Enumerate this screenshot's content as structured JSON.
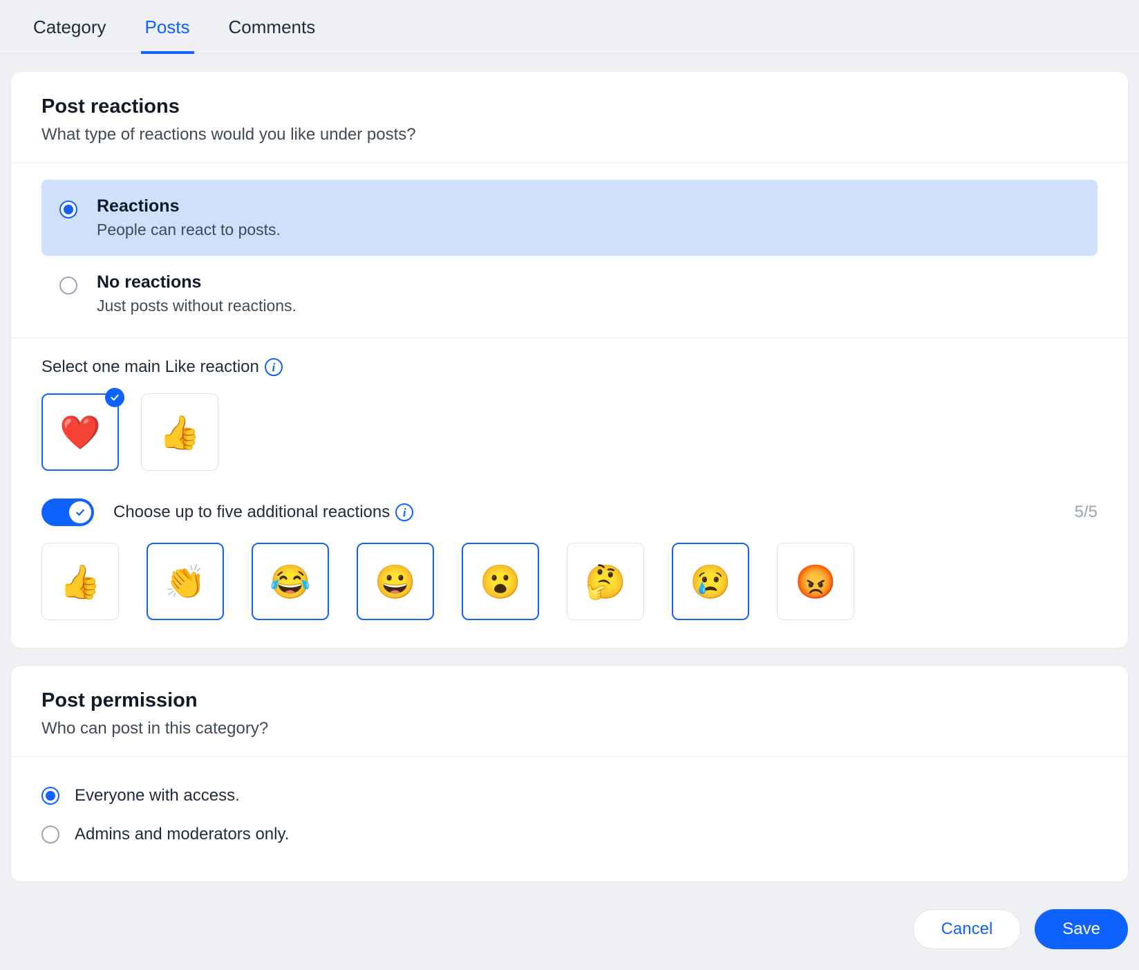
{
  "tabs": [
    {
      "id": "category",
      "label": "Category",
      "active": false
    },
    {
      "id": "posts",
      "label": "Posts",
      "active": true
    },
    {
      "id": "comments",
      "label": "Comments",
      "active": false
    }
  ],
  "reactions_section": {
    "title": "Post reactions",
    "subtitle": "What type of reactions would you like under posts?",
    "options": [
      {
        "id": "reactions-on",
        "title": "Reactions",
        "desc": "People can react to posts.",
        "selected": true
      },
      {
        "id": "reactions-off",
        "title": "No reactions",
        "desc": "Just posts without reactions.",
        "selected": false
      }
    ],
    "main_like_label": "Select one main Like reaction",
    "main_like_choices": [
      {
        "id": "heart",
        "emoji": "❤️",
        "selected": true
      },
      {
        "id": "thumbs-up",
        "emoji": "👍",
        "selected": false
      }
    ],
    "additional": {
      "toggle_on": true,
      "label": "Choose up to five additional reactions",
      "counter": "5/5",
      "choices": [
        {
          "id": "thumbs-up",
          "emoji": "👍",
          "selected": false
        },
        {
          "id": "clap",
          "emoji": "👏",
          "selected": true
        },
        {
          "id": "joy",
          "emoji": "😂",
          "selected": true
        },
        {
          "id": "smile",
          "emoji": "😀",
          "selected": true
        },
        {
          "id": "wow",
          "emoji": "😮",
          "selected": true
        },
        {
          "id": "thinking",
          "emoji": "🤔",
          "selected": false
        },
        {
          "id": "sad",
          "emoji": "😢",
          "selected": true
        },
        {
          "id": "angry",
          "emoji": "😡",
          "selected": false
        }
      ]
    }
  },
  "permission_section": {
    "title": "Post permission",
    "subtitle": "Who can post in this category?",
    "options": [
      {
        "id": "everyone",
        "label": "Everyone with access.",
        "selected": true
      },
      {
        "id": "admins",
        "label": "Admins and moderators only.",
        "selected": false
      }
    ]
  },
  "footer": {
    "cancel": "Cancel",
    "save": "Save"
  }
}
